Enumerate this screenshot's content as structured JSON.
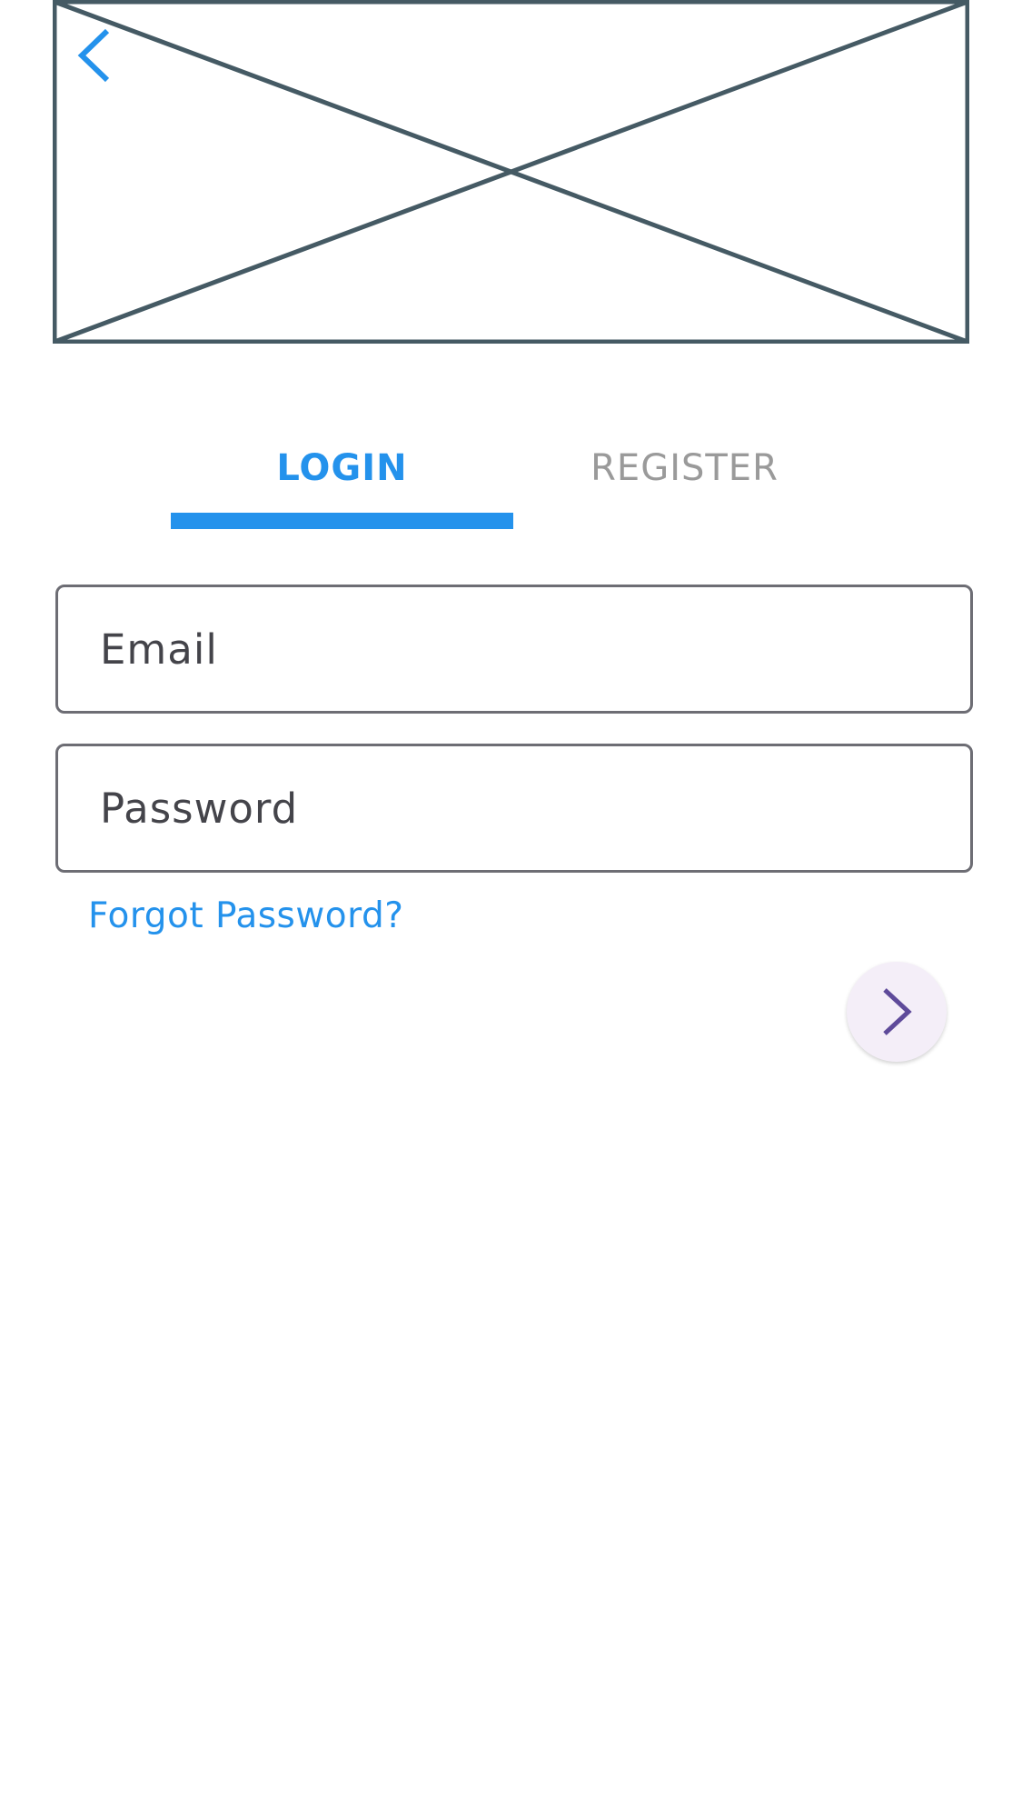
{
  "header": {
    "back_icon": "chevron-left-icon",
    "hero_placeholder": "image-placeholder"
  },
  "tabs": {
    "active": "login",
    "items": [
      {
        "id": "login",
        "label": "LOGIN"
      },
      {
        "id": "register",
        "label": "REGISTER"
      }
    ]
  },
  "form": {
    "email_placeholder": "Email",
    "email_value": "",
    "password_placeholder": "Password",
    "password_value": "",
    "forgot_label": "Forgot Password?",
    "submit_icon": "chevron-right-icon"
  },
  "colors": {
    "accent": "#2492ec",
    "tab_inactive": "#9a9a9a",
    "placeholder_stroke": "#455a64",
    "field_border": "#6d6d74",
    "submit_icon": "#5e4a9a",
    "submit_bg": "#f4eef8"
  }
}
